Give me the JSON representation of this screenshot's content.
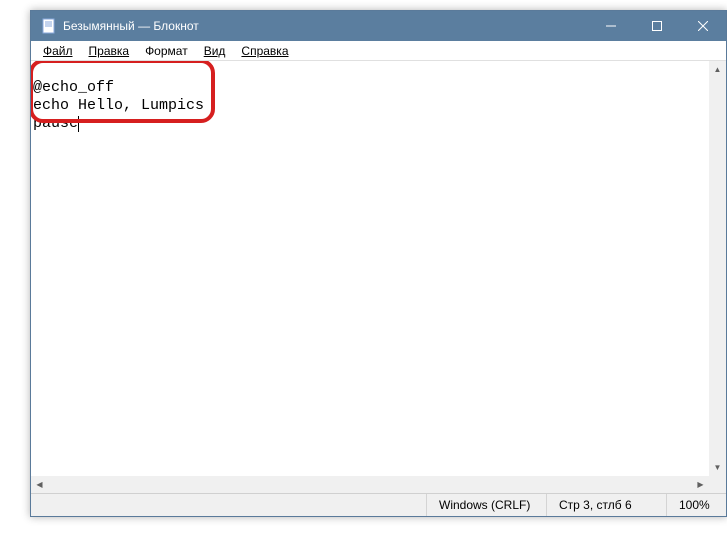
{
  "titlebar": {
    "title": "Безымянный — Блокнот"
  },
  "menu": {
    "file": "Файл",
    "edit": "Правка",
    "format": "Формат",
    "view": "Вид",
    "help": "Справка"
  },
  "editor": {
    "line1": "@echo_off",
    "line2": "echo Hello, Lumpics",
    "line3": "pause"
  },
  "statusbar": {
    "encoding": "Windows (CRLF)",
    "position": "Стр 3, стлб 6",
    "zoom": "100%"
  }
}
